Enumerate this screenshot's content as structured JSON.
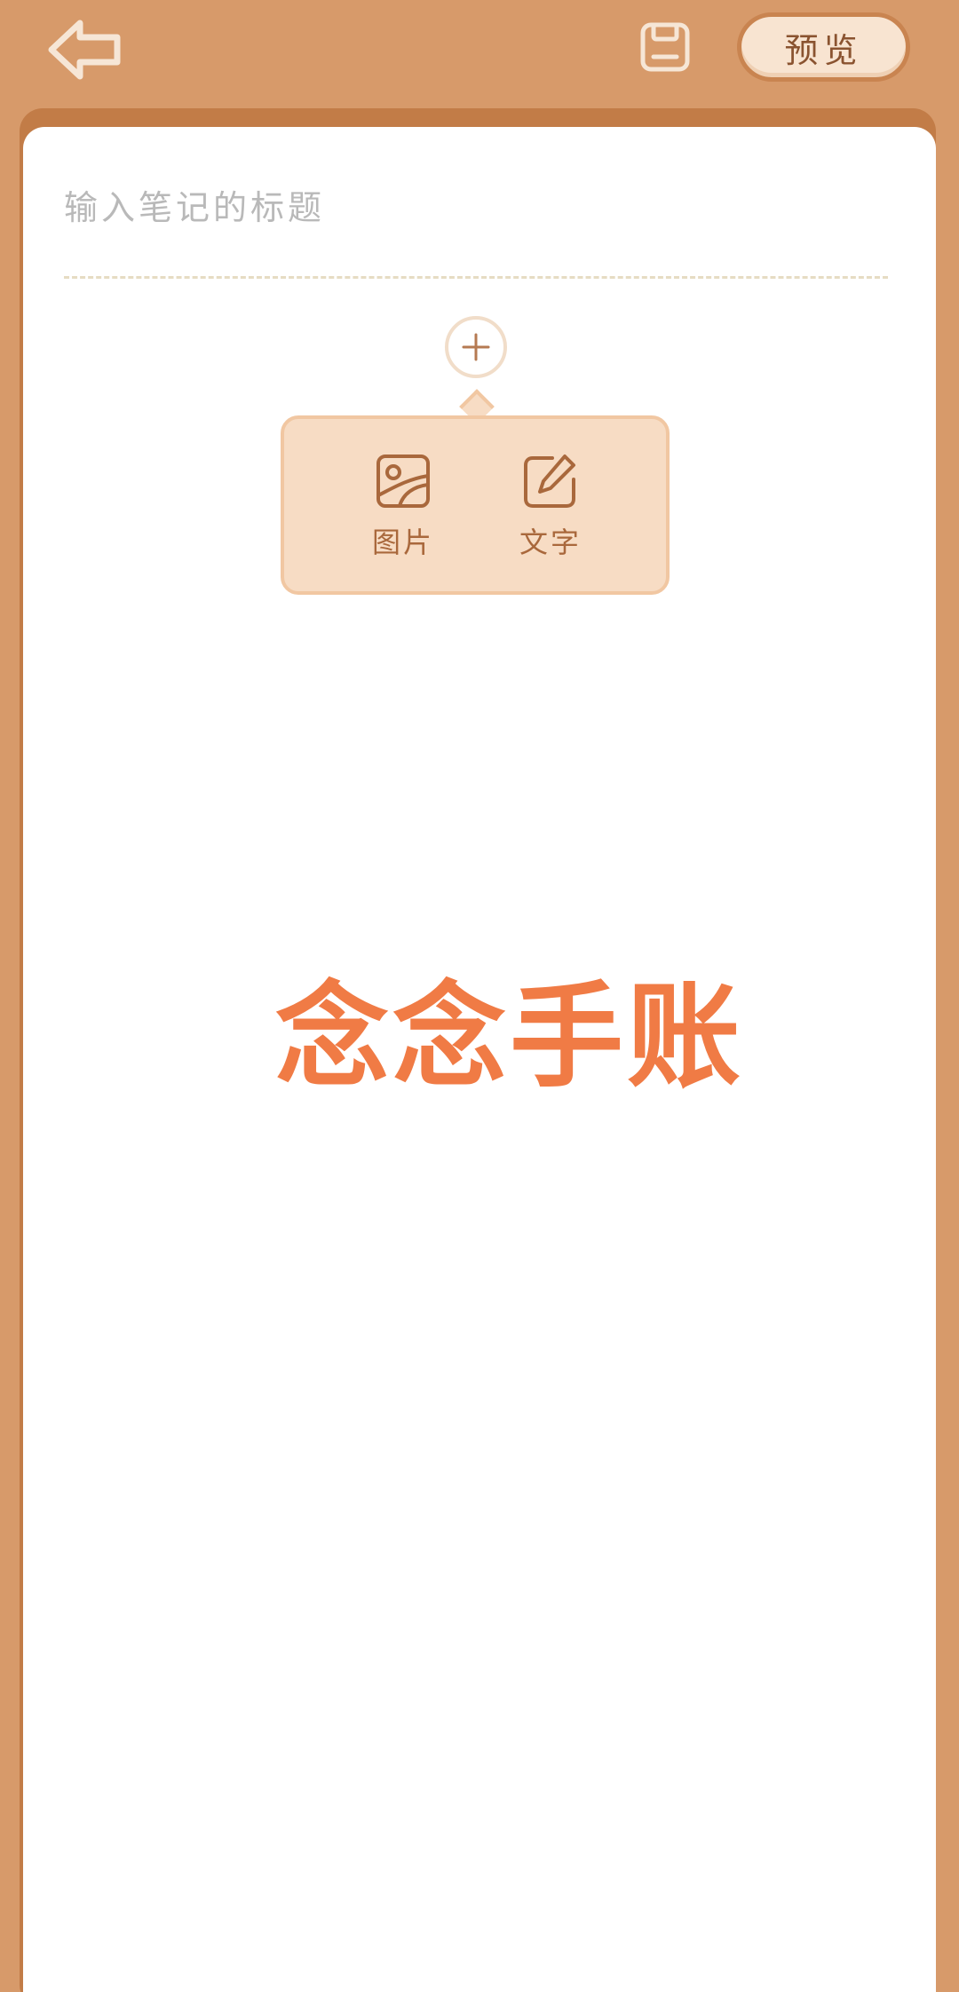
{
  "header": {
    "back_icon": "back-arrow-icon",
    "save_icon": "floppy-disk-icon",
    "preview_label": "预览"
  },
  "editor": {
    "title_placeholder": "输入笔记的标题",
    "title_value": "",
    "add_icon": "plus-icon"
  },
  "add_menu": {
    "items": [
      {
        "label": "图片",
        "icon": "image-icon"
      },
      {
        "label": "文字",
        "icon": "edit-text-icon"
      }
    ]
  },
  "watermark": {
    "text": "念念手账"
  },
  "colors": {
    "background": "#d79a6a",
    "accent": "#f07b45",
    "popup": "#f7dcc4",
    "icon_stroke": "#a9683c"
  }
}
